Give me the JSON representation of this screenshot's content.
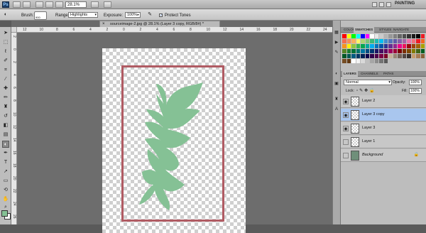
{
  "app": {
    "logo": "Ps",
    "zoom": "28.1%",
    "workspace": "PAINTING",
    "window_buttons": [
      "–",
      "□",
      "✕"
    ]
  },
  "options_bar": {
    "brush_label": "Brush:",
    "brush_size": "900",
    "range_label": "Range:",
    "range_value": "Highlights",
    "exposure_label": "Exposure:",
    "exposure_value": "100%",
    "protect_tones_label": "Protect Tones",
    "protect_tones_checked": true
  },
  "document": {
    "tab_title": "sourceimage-2.jpg @ 28.1% (Layer 3 copy, RGB/8#) *",
    "close": "×"
  },
  "rulers": {
    "horizontal": [
      "12",
      "10",
      "8",
      "6",
      "4",
      "2",
      "0",
      "2",
      "4",
      "6",
      "8",
      "10",
      "12",
      "14",
      "16",
      "18",
      "20",
      "22",
      "24"
    ],
    "vertical": [
      "2",
      "0",
      "2",
      "4",
      "6",
      "8",
      "1\n0",
      "1\n2",
      "1\n4",
      "1\n6",
      "1\n8",
      "2\n0",
      "2\n2",
      "2\n4",
      "2\n6"
    ]
  },
  "colors": {
    "foreground": "#85c195",
    "background": "#ffffff",
    "leaf": "#85c195",
    "frame": "#b05b63",
    "selected_layer": "#a9c6ee"
  },
  "swatch_panel": {
    "tabs": [
      "COLOR",
      "SWATCHES",
      "STYLES",
      "NAVIGATE"
    ]
  },
  "layers_panel": {
    "tabs": [
      "LAYERS",
      "CHANNELS",
      "PATHS"
    ],
    "blend_mode": "Normal",
    "opacity_label": "Opacity:",
    "opacity_value": "100%",
    "lock_label": "Lock:",
    "fill_label": "Fill:",
    "fill_value": "100%",
    "layers": [
      {
        "name": "Layer 2",
        "visible": true,
        "selected": false
      },
      {
        "name": "Layer 3 copy",
        "visible": true,
        "selected": true
      },
      {
        "name": "Layer 3",
        "visible": true,
        "selected": false
      },
      {
        "name": "Layer 1",
        "visible": false,
        "selected": false
      },
      {
        "name": "Background",
        "visible": false,
        "selected": false,
        "locked": true
      }
    ]
  }
}
